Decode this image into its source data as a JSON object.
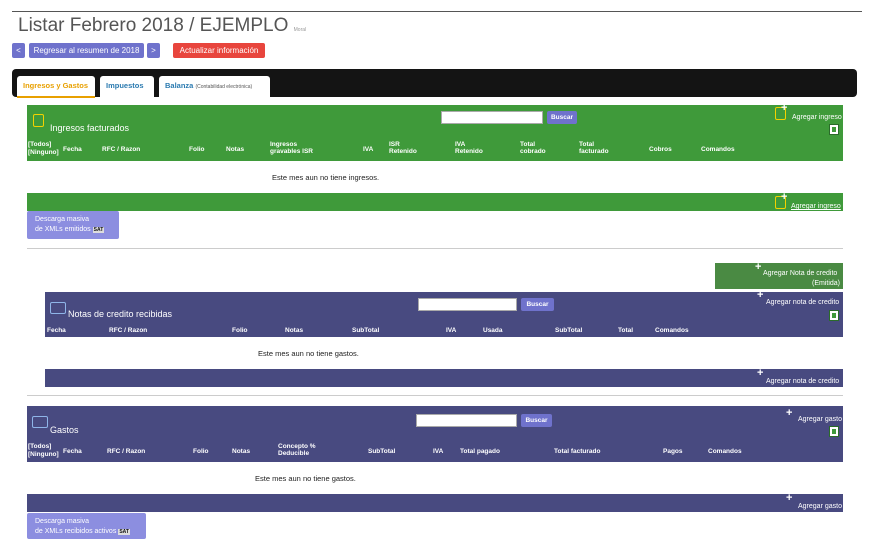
{
  "page": {
    "title": "Listar Febrero 2018 / EJEMPLO",
    "subtitle": "Moral"
  },
  "nav": {
    "prev": "<",
    "back": "Regresar al resumen de 2018",
    "next": ">",
    "update": "Actualizar información"
  },
  "tabs": [
    {
      "label": "Ingresos y Gastos",
      "note": ""
    },
    {
      "label": "Impuestos",
      "note": ""
    },
    {
      "label": "Balanza",
      "note": "(Contabilidad electrónica)"
    }
  ],
  "ingresos": {
    "title": "Ingresos facturados",
    "search_button": "Buscar",
    "add_top": "Agregar ingreso",
    "add_bottom": "Agregar ingreso",
    "select_all": "[Todos]",
    "select_none": "[Ninguno]",
    "columns": [
      "Fecha",
      "RFC / Razon",
      "Folio",
      "Notas",
      "Ingresos gravables ISR",
      "IVA",
      "ISR Retenido",
      "IVA Retenido",
      "Total cobrado",
      "Total facturado",
      "Cobros",
      "Comandos"
    ],
    "empty": "Este mes aun no tiene ingresos.",
    "download": {
      "line1": "Descarga masiva",
      "line2": "de XMLs emitidos",
      "badge": "SAT"
    }
  },
  "credit_emitida": {
    "label": "Agregar Nota de credito",
    "sub": "(Emitida)"
  },
  "notas": {
    "title": "Notas de credito recibidas",
    "search_button": "Buscar",
    "add_top": "Agregar nota de credito",
    "add_bottom": "Agregar nota de credito",
    "columns": [
      "Fecha",
      "RFC / Razon",
      "Folio",
      "Notas",
      "SubTotal",
      "IVA",
      "Usada",
      "SubTotal",
      "Total",
      "Comandos"
    ],
    "empty": "Este mes aun no tiene gastos."
  },
  "gastos": {
    "title": "Gastos",
    "search_button": "Buscar",
    "add_top": "Agregar gasto",
    "add_bottom": "Agregar gasto",
    "select_all": "[Todos]",
    "select_none": "[Ninguno]",
    "columns": [
      "Fecha",
      "RFC / Razon",
      "Folio",
      "Notas",
      "Concepto % Deducible",
      "SubTotal",
      "IVA",
      "Total pagado",
      "Total facturado",
      "Pagos",
      "Comandos"
    ],
    "empty": "Este mes aun no tiene gastos.",
    "download": {
      "line1": "Descarga masiva",
      "line2": "de XMLs recibidos activos",
      "badge": "SAT"
    }
  },
  "colors": {
    "green": "#3f9a3a",
    "purple": "#484a80",
    "button_blue": "#6f72cc",
    "button_red": "#e8453d",
    "tab_active": "#e8a000",
    "tab_link": "#2a7ab0",
    "download": "#8c8ee0"
  }
}
